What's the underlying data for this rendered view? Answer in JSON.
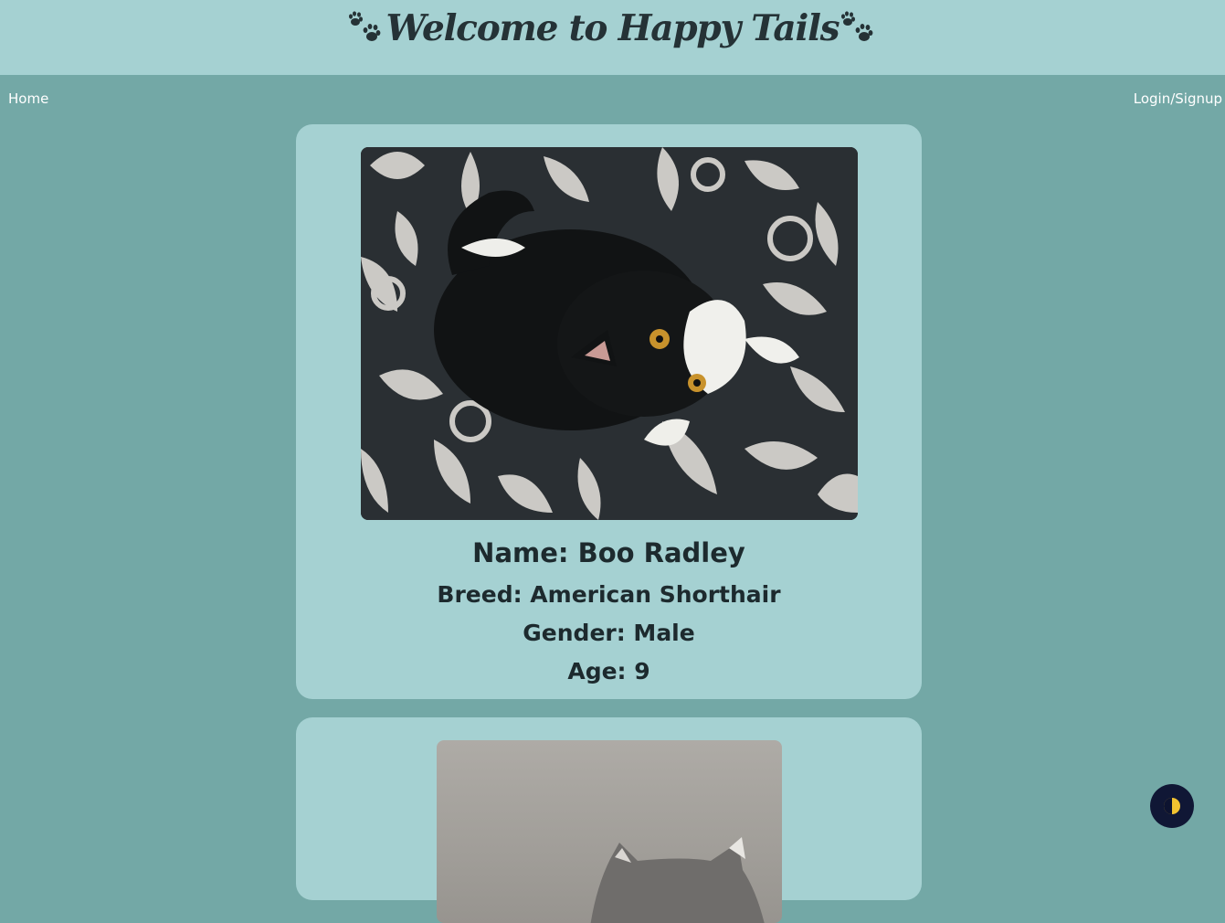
{
  "header": {
    "title": "Welcome to Happy Tails",
    "left_icon": "paw-prints-icon",
    "right_icon": "paw-prints-icon"
  },
  "nav": {
    "home": "Home",
    "login": "Login/Signup"
  },
  "pets": [
    {
      "name": "Name: Boo Radley",
      "breed": "Breed: American Shorthair",
      "gender": "Gender: Male",
      "age": "Age: 9",
      "photo": "black-and-white-cat-photo"
    },
    {
      "photo": "gray-cat-photo"
    }
  ],
  "theme_toggle": {
    "icon": "half-moon-icon"
  },
  "colors": {
    "page_bg": "#73a8a6",
    "header_bg": "#a5d1d2",
    "card_bg": "#a5d1d2",
    "text_dark": "#1d2a2e",
    "toggle_bg": "#101735",
    "toggle_accent": "#f2c230"
  }
}
